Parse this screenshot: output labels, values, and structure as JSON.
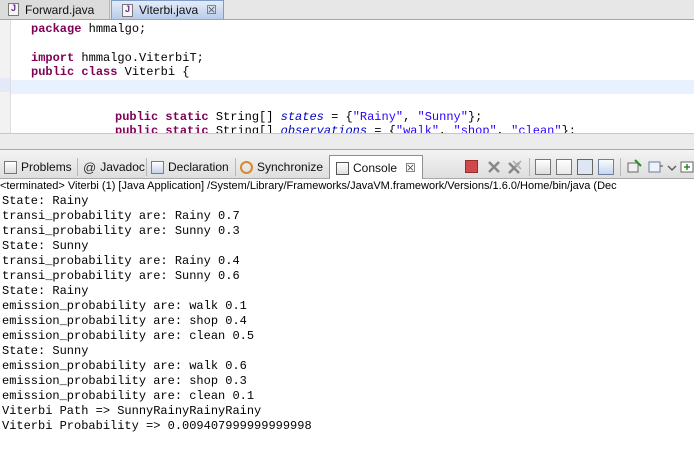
{
  "editor_tabs": [
    {
      "label": "Forward.java",
      "active": false
    },
    {
      "label": "Viterbi.java",
      "active": true
    }
  ],
  "code": {
    "package_kw": "package",
    "package_name": " hmmalgo;",
    "import_kw": "import",
    "import_name": " hmmalgo.ViterbiT;",
    "public_kw": "public",
    "class_kw": "class",
    "class_name": " Viterbi {",
    "line6_public": "public",
    "line6_static": "static",
    "line6_type": " String[] ",
    "line6_var": "states",
    "line6_eq": " = {",
    "line6_s1": "\"Rainy\"",
    "line6_comma": ", ",
    "line6_s2": "\"Sunny\"",
    "line6_end": "};",
    "line7_public": "public",
    "line7_static": "static",
    "line7_type": " String[] ",
    "line7_var": "observations",
    "line7_eq": " = {",
    "line7_s1": "\"walk\"",
    "line7_s2": "\"shop\"",
    "line7_s3": "\"clean\"",
    "line7_end": "};"
  },
  "views": {
    "problems": "Problems",
    "javadoc": "Javadoc",
    "declaration": "Declaration",
    "synchronize": "Synchronize",
    "console": "Console",
    "close_glyph": "☒",
    "javadoc_at": "@"
  },
  "console": {
    "header": "<terminated> Viterbi (1) [Java Application] /System/Library/Frameworks/JavaVM.framework/Versions/1.6.0/Home/bin/java (Dec",
    "lines": [
      "State: Rainy",
      "transi_probability are: Rainy 0.7",
      "transi_probability are: Sunny 0.3",
      "State: Sunny",
      "transi_probability are: Rainy 0.4",
      "transi_probability are: Sunny 0.6",
      "State: Rainy",
      "emission_probability are: walk 0.1",
      "emission_probability are: shop 0.4",
      "emission_probability are: clean 0.5",
      "State: Sunny",
      "emission_probability are: walk 0.6",
      "emission_probability are: shop 0.3",
      "emission_probability are: clean 0.1",
      "Viterbi Path => SunnyRainyRainyRainy",
      "Viterbi Probability => 0.009407999999999998"
    ]
  }
}
